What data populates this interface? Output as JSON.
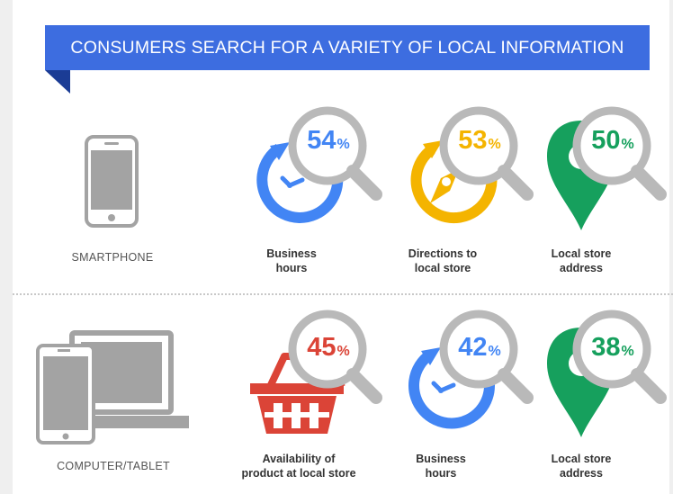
{
  "header": {
    "title": "CONSUMERS SEARCH FOR A VARIETY OF LOCAL INFORMATION"
  },
  "colors": {
    "banner": "#3d6de0",
    "blue": "#4285f4",
    "yellow": "#f4b400",
    "green": "#16a05d",
    "red": "#db4437",
    "magnifier": "#b9b9b9",
    "device": "#a3a3a3"
  },
  "rows": [
    {
      "device_label": "SMARTPHONE",
      "device_icon": "smartphone-icon",
      "items": [
        {
          "percent": "54",
          "symbol": "%",
          "color": "#4285f4",
          "icon": "clock-icon",
          "caption_line1": "Business",
          "caption_line2": "hours"
        },
        {
          "percent": "53",
          "symbol": "%",
          "color": "#f4b400",
          "icon": "compass-icon",
          "caption_line1": "Directions to",
          "caption_line2": "local store"
        },
        {
          "percent": "50",
          "symbol": "%",
          "color": "#16a05d",
          "icon": "map-pin-icon",
          "caption_line1": "Local store",
          "caption_line2": "address"
        }
      ]
    },
    {
      "device_label": "COMPUTER/TABLET",
      "device_icon": "computer-tablet-icon",
      "items": [
        {
          "percent": "45",
          "symbol": "%",
          "color": "#db4437",
          "icon": "shopping-basket-icon",
          "caption_line1": "Availability of",
          "caption_line2": "product at local store"
        },
        {
          "percent": "42",
          "symbol": "%",
          "color": "#4285f4",
          "icon": "clock-icon",
          "caption_line1": "Business",
          "caption_line2": "hours"
        },
        {
          "percent": "38",
          "symbol": "%",
          "color": "#16a05d",
          "icon": "map-pin-icon",
          "caption_line1": "Local store",
          "caption_line2": "address"
        }
      ]
    }
  ]
}
